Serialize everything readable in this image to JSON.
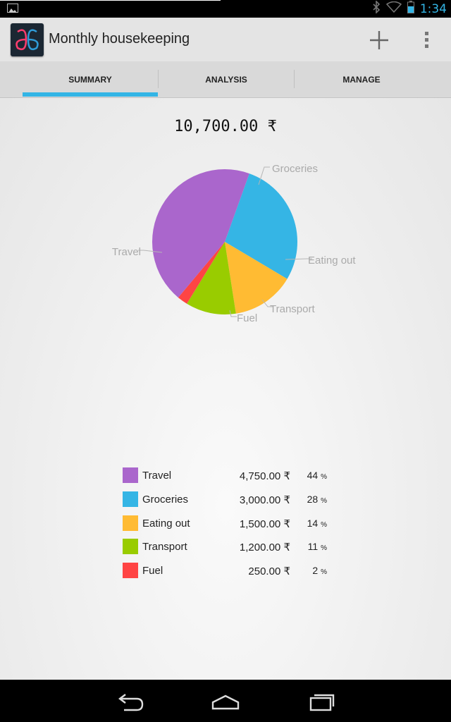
{
  "status_bar": {
    "time": "1:34"
  },
  "app": {
    "title": "Monthly housekeeping"
  },
  "tabs": [
    {
      "label": "SUMMARY",
      "selected": true
    },
    {
      "label": "ANALYSIS",
      "selected": false
    },
    {
      "label": "MANAGE",
      "selected": false
    }
  ],
  "summary": {
    "total": "10,700.00 ₹"
  },
  "chart_data": {
    "type": "pie",
    "slices": [
      {
        "label": "Groceries",
        "value": 3000,
        "color": "#35b5e5"
      },
      {
        "label": "Eating out",
        "value": 1500,
        "color": "#ffbb33"
      },
      {
        "label": "Transport",
        "value": 1200,
        "color": "#99cc00"
      },
      {
        "label": "Fuel",
        "value": 250,
        "color": "#ff4444"
      },
      {
        "label": "Travel",
        "value": 4750,
        "color": "#aa66cc"
      }
    ]
  },
  "legend": [
    {
      "name": "Travel",
      "amount": "4,750.00 ₹",
      "pct": "44",
      "color": "#aa66cc"
    },
    {
      "name": "Groceries",
      "amount": "3,000.00 ₹",
      "pct": "28",
      "color": "#35b5e5"
    },
    {
      "name": "Eating out",
      "amount": "1,500.00 ₹",
      "pct": "14",
      "color": "#ffbb33"
    },
    {
      "name": "Transport",
      "amount": "1,200.00 ₹",
      "pct": "11",
      "color": "#99cc00"
    },
    {
      "name": "Fuel",
      "amount": "250.00 ₹",
      "pct": "2",
      "color": "#ff4444"
    }
  ],
  "pct_symbol": "%",
  "nav": [
    "back-icon",
    "home-icon",
    "recents-icon"
  ]
}
